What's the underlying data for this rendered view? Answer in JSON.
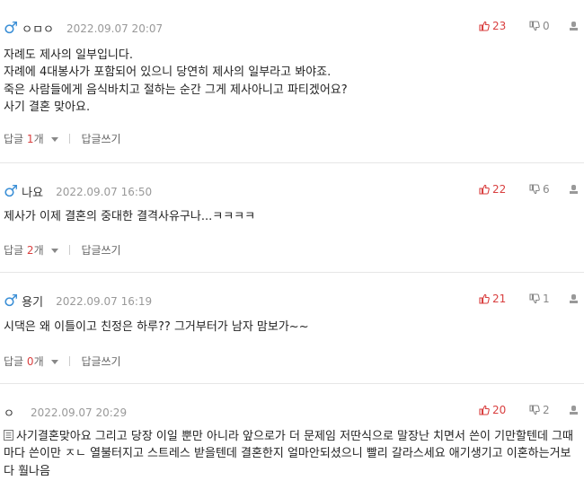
{
  "labels": {
    "reply": "답글",
    "reply_unit": "개",
    "write_reply": "답글쓰기"
  },
  "comments": [
    {
      "nick": "ㅇㅁㅇ",
      "date": "2022.09.07 20:07",
      "up": "23",
      "down": "0",
      "lines": [
        "자례도 제사의 일부입니다.",
        "자례에 4대봉사가 포함되어 있으니 당연히 제사의 일부라고 봐야죠.",
        "죽은 사람들에게 음식바치고 절하는 순간 그게 제사아니고 파티겠어요?",
        "사기 결혼 맞아요."
      ],
      "reply_count": "1"
    },
    {
      "nick": "나요",
      "date": "2022.09.07 16:50",
      "up": "22",
      "down": "6",
      "lines": [
        "제사가 이제 결혼의 중대한 결격사유구나...ㅋㅋㅋㅋ"
      ],
      "reply_count": "2"
    },
    {
      "nick": "용기",
      "date": "2022.09.07 16:19",
      "up": "21",
      "down": "1",
      "lines": [
        "시댁은 왜 이틀이고 친정은 하루?? 그거부터가 남자 맘보가~~"
      ],
      "reply_count": "0"
    },
    {
      "nick": "ㅇ",
      "date": "2022.09.07 20:29",
      "up": "20",
      "down": "2",
      "text": "사기결혼맞아요 그리고 당장 이일 뿐만 아니라 앞으로가 더 문제임 저딴식으로 말장난 치면서 쓴이 기만할텐데 그때마다 쓴이만 ㅈㄴ 열불터지고 스트레스 받을텐데 결혼한지 얼마안되셨으니 빨리 갈라스세요 애기생기고 이혼하는거보다 훨나음"
    }
  ]
}
